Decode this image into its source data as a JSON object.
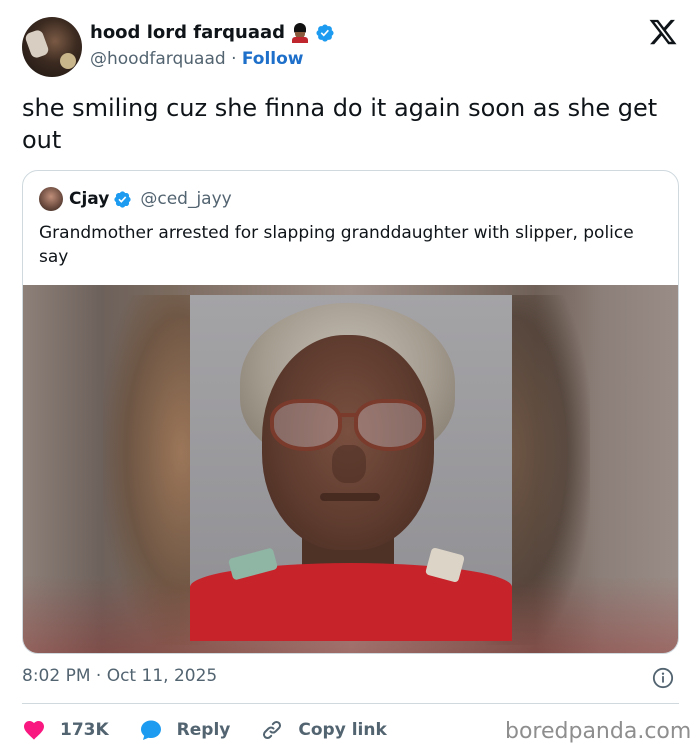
{
  "author": {
    "display_name": "hood lord farquaad",
    "handle": "@hoodfarquaad",
    "separator": "·",
    "follow_label": "Follow"
  },
  "tweet": {
    "text": "she smiling cuz she finna do it again soon as she get out",
    "timestamp": "8:02 PM · Oct 11, 2025"
  },
  "quoted": {
    "display_name": "Cjay",
    "handle": "@ced_jayy",
    "text": "Grandmother arrested for slapping granddaughter with slipper, police say"
  },
  "actions": {
    "likes": "173K",
    "reply_label": "Reply",
    "copy_link_label": "Copy link"
  },
  "watermark": "boredpanda.com",
  "colors": {
    "accent": "#1d9bf0",
    "follow": "#1d6fc9",
    "like": "#f91880",
    "muted": "#536471",
    "border": "#cfd9de"
  },
  "icons": {
    "verified": "verified-badge-icon",
    "x_logo": "x-logo-icon",
    "info": "info-icon",
    "like": "heart-icon",
    "reply": "speech-bubble-icon",
    "copy_link": "link-icon"
  }
}
